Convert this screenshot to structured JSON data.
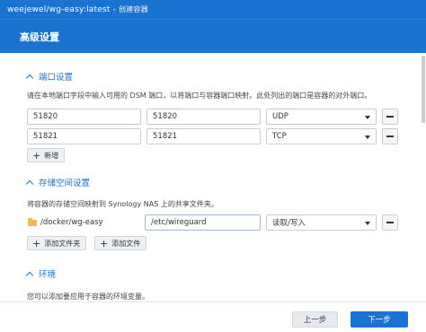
{
  "window": {
    "title": "weejewel/wg-easy:latest",
    "separator": "-",
    "subtitle": "创建容器"
  },
  "header": {
    "title": "高级设置"
  },
  "port_section": {
    "title": "端口设置",
    "description": "请在本地端口字段中输入可用的 DSM 端口，以将端口与容器端口映射。此处列出的端口是容器的对外端口。",
    "rows": [
      {
        "local_port": "51820",
        "container_port": "51820",
        "protocol": "UDP"
      },
      {
        "local_port": "51821",
        "container_port": "51821",
        "protocol": "TCP"
      }
    ],
    "add_label": "新增"
  },
  "storage_section": {
    "title": "存储空间设置",
    "description": "将容器的存储空间映射到 Synology NAS 上的共享文件夹。",
    "rows": [
      {
        "host_path": "/docker/wg-easy",
        "mount_path": "/etc/wireguard",
        "mode": "读取/写入"
      }
    ],
    "add_folder_label": "添加文件夹",
    "add_file_label": "添加文件"
  },
  "env_section": {
    "title": "环境",
    "description": "您可以添加要应用于容器的环境变量。"
  },
  "footer": {
    "prev_label": "上一步",
    "next_label": "下一步"
  }
}
